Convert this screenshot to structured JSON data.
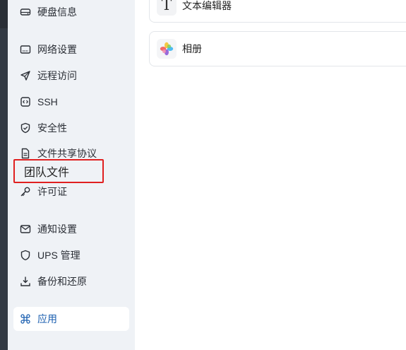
{
  "sidebar": {
    "items": [
      {
        "label": "硬盘信息",
        "icon": "disk-icon"
      },
      {
        "label": "网络设置",
        "icon": "network-icon"
      },
      {
        "label": "远程访问",
        "icon": "send-icon"
      },
      {
        "label": "SSH",
        "icon": "code-icon"
      },
      {
        "label": "安全性",
        "icon": "shield-check-icon"
      },
      {
        "label": "文件共享协议",
        "icon": "document-icon"
      },
      {
        "label": "许可证",
        "icon": "key-icon"
      },
      {
        "label": "通知设置",
        "icon": "mail-icon"
      },
      {
        "label": "UPS 管理",
        "icon": "shield-icon"
      },
      {
        "label": "备份和还原",
        "icon": "download-tray-icon"
      },
      {
        "label": "应用",
        "icon": "command-icon",
        "active": true
      }
    ],
    "highlight_label": "团队文件"
  },
  "main": {
    "cards": [
      {
        "label": "文本编辑器",
        "icon": "text-editor-icon"
      },
      {
        "label": "相册",
        "icon": "photos-icon"
      }
    ]
  },
  "colors": {
    "sidebar_bg": "#eff2f6",
    "active_text": "#1b5fb0",
    "highlight_border": "#e02020"
  }
}
